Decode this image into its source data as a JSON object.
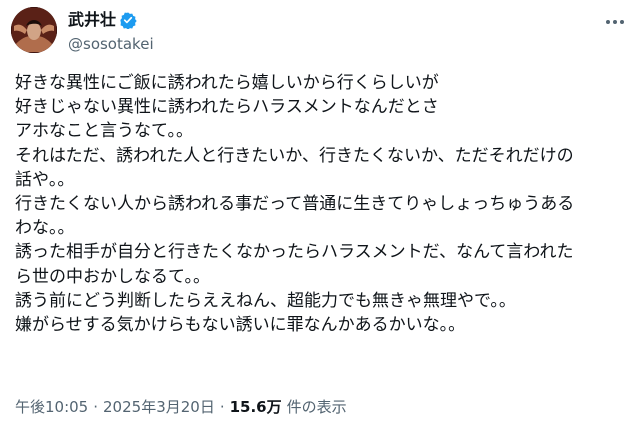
{
  "author": {
    "display_name": "武井壮",
    "handle": "@sosotakei",
    "verified_icon": "verified-badge-icon",
    "avatar": "profile-avatar",
    "menu_icon": "more-options-icon",
    "accent_color": "#1d9bf0"
  },
  "tweet": {
    "lines": [
      "好きな異性にご飯に誘われたら嬉しいから行くらしいが",
      "好きじゃない異性に誘われたらハラスメントなんだとさ",
      "アホなこと言うなて。。",
      "それはただ、誘われた人と行きたいか、行きたくないか、ただそれだけの",
      "話や。。",
      "行きたくない人から誘われる事だって普通に生きてりゃしょっちゅうある",
      "わな。。",
      "誘った相手が自分と行きたくなかったらハラスメントだ、なんて言われた",
      "ら世の中おかしなるて。。",
      "誘う前にどう判断したらええねん、超能力でも無きゃ無理やで。。",
      "嫌がらせする気かけらもない誘いに罪なんかあるかいな。。"
    ]
  },
  "meta": {
    "time": "午後10:05",
    "separator": "·",
    "date": "2025年3月20日",
    "views_count": "15.6万",
    "views_label": "件の表示"
  }
}
